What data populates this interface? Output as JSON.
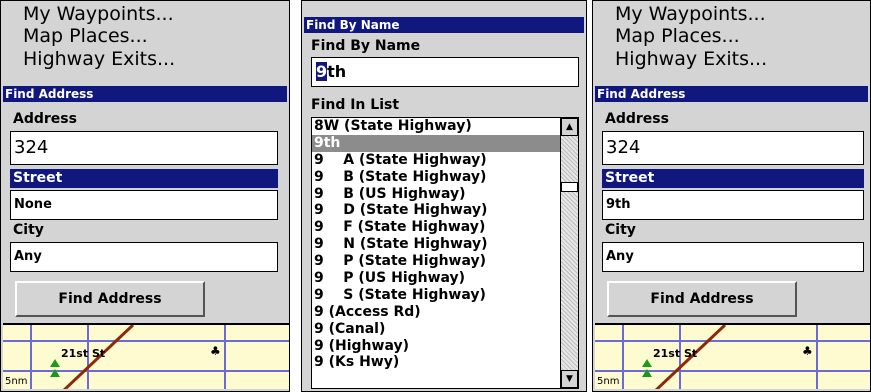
{
  "left": {
    "menu": [
      "My Waypoints...",
      "Map Places...",
      "Highway Exits..."
    ],
    "title": "Find Address",
    "address_label": "Address",
    "address_value": "324",
    "street_label": "Street",
    "street_value": "None",
    "city_label": "City",
    "city_value": "Any",
    "button": "Find Address",
    "map": {
      "street": "21st St",
      "scale": "5nm"
    }
  },
  "middle": {
    "title": "Find By Name",
    "field_label": "Find By Name",
    "input_cursor": "9",
    "input_rest": "th",
    "list_label": "Find In List",
    "list_items": [
      "8W (State Highway)",
      "9th",
      "9    A (State Highway)",
      "9    B (State Highway)",
      "9    B (US Highway)",
      "9    D (State Highway)",
      "9    F (State Highway)",
      "9    N (State Highway)",
      "9    P (State Highway)",
      "9    P (US Highway)",
      "9    S (State Highway)",
      "9 (Access Rd)",
      "9 (Canal)",
      "9 (Highway)",
      "9 (Ks Hwy)"
    ],
    "selected_index": 1
  },
  "right": {
    "menu": [
      "My Waypoints...",
      "Map Places...",
      "Highway Exits..."
    ],
    "title": "Find Address",
    "address_label": "Address",
    "address_value": "324",
    "street_label": "Street",
    "street_value": "9th",
    "city_label": "City",
    "city_value": "Any",
    "button": "Find Address",
    "map": {
      "street": "21st St",
      "scale": "5nm"
    }
  },
  "colors": {
    "title_bar": "#101880",
    "panel": "#d4d4d4",
    "map_bg": "#fffbd0",
    "road": "#8b2a0a"
  }
}
